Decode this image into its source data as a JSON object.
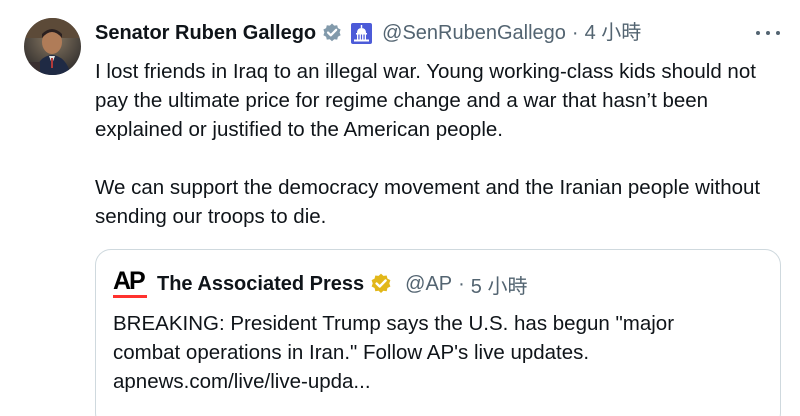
{
  "tweet": {
    "author_name": "Senator Ruben Gallego",
    "handle": "@SenRubenGallego",
    "separator": "·",
    "time": "4 小時",
    "verified_badge_icon": "gray-verified-check-icon",
    "affiliation_icon": "us-capitol-icon",
    "paragraphs": [
      "I lost friends in Iraq to an illegal war. Young working-class kids should not pay the ultimate price for regime change and a war that hasn’t been explained or justified to the American people.",
      "We can support the democracy movement and the Iranian people without sending our troops to die."
    ]
  },
  "quote": {
    "logo_text": "AP",
    "author_name": "The Associated Press",
    "verified_badge_icon": "gold-verified-check-icon",
    "handle": "@AP",
    "separator": "·",
    "time": "5 小時",
    "lines": [
      "BREAKING: President Trump says the U.S. has begun \"major",
      "combat operations in Iran.\" Follow AP's live updates.",
      "apnews.com/live/live-upda..."
    ]
  },
  "colors": {
    "text_primary": "#0f1419",
    "text_secondary": "#536471",
    "border": "#cfd9de",
    "gray_badge": "#829aab",
    "gold_badge": "#e2b719",
    "capitol_badge_bg": "#4c5bd8",
    "ap_red": "#ff322e"
  }
}
